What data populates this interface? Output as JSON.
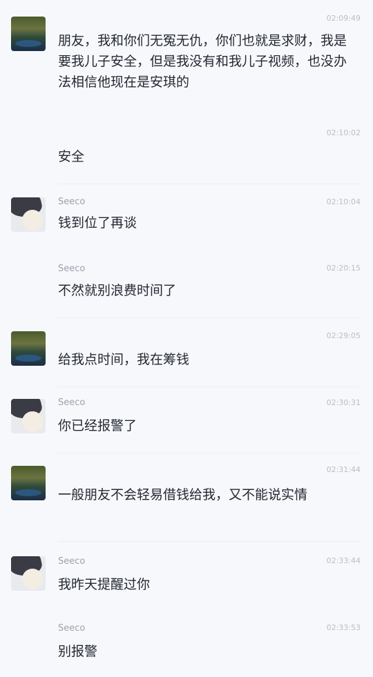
{
  "messages": [
    {
      "side": "me",
      "sender": "",
      "time": "02:09:49",
      "text": "朋友，我和你们无冤无仇，你们也就是求财，我是要我儿子安全，但是我没有和我儿子视频，也没办法相信他现在是安琪的"
    },
    {
      "side": "me",
      "sender": "",
      "time": "02:10:02",
      "text": "安全"
    },
    {
      "side": "other",
      "sender": "Seeco",
      "time": "02:10:04",
      "text": "钱到位了再谈"
    },
    {
      "side": "other",
      "sender": "Seeco",
      "time": "02:20:15",
      "text": "不然就别浪费时间了"
    },
    {
      "side": "me",
      "sender": "",
      "time": "02:29:05",
      "text": "给我点时间，我在筹钱"
    },
    {
      "side": "other",
      "sender": "Seeco",
      "time": "02:30:31",
      "text": "你已经报警了"
    },
    {
      "side": "me",
      "sender": "",
      "time": "02:31:44",
      "text": "一般朋友不会轻易借钱给我，又不能说实情"
    },
    {
      "side": "other",
      "sender": "Seeco",
      "time": "02:33:44",
      "text": "我昨天提醒过你"
    },
    {
      "side": "other",
      "sender": "Seeco",
      "time": "02:33:53",
      "text": "别报警"
    }
  ]
}
